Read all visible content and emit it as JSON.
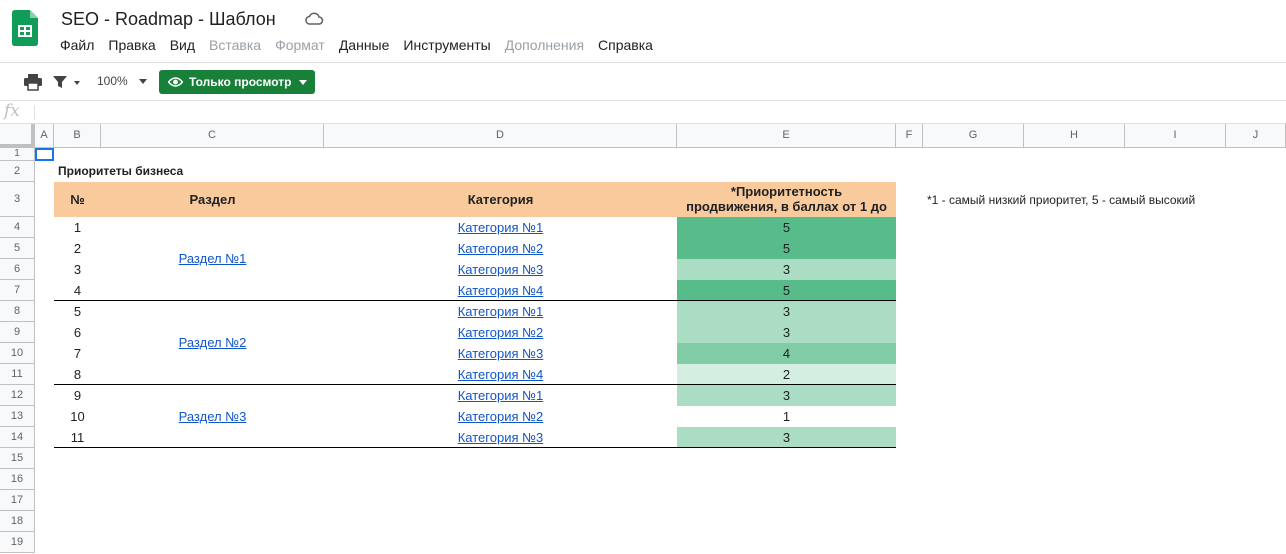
{
  "doc": {
    "title": "SEO - Roadmap - Шаблон"
  },
  "menu": [
    {
      "label": "Файл",
      "enabled": true
    },
    {
      "label": "Правка",
      "enabled": true
    },
    {
      "label": "Вид",
      "enabled": true
    },
    {
      "label": "Вставка",
      "enabled": false
    },
    {
      "label": "Формат",
      "enabled": false
    },
    {
      "label": "Данные",
      "enabled": true
    },
    {
      "label": "Инструменты",
      "enabled": true
    },
    {
      "label": "Дополнения",
      "enabled": false
    },
    {
      "label": "Справка",
      "enabled": true
    }
  ],
  "toolbar": {
    "zoom": "100%",
    "view_only_label": "Только просмотр"
  },
  "formula_bar": {
    "fx_label": "fx",
    "value": ""
  },
  "columns": [
    "A",
    "B",
    "C",
    "D",
    "E",
    "F",
    "G",
    "H",
    "I",
    "J"
  ],
  "rows": [
    "1",
    "2",
    "3",
    "4",
    "5",
    "6",
    "7",
    "8",
    "9",
    "10",
    "11",
    "12",
    "13",
    "14",
    "15",
    "16",
    "17",
    "18",
    "19"
  ],
  "sheet": {
    "title": "Приоритеты бизнеса",
    "headers": {
      "num": "№",
      "section": "Раздел",
      "category": "Категория",
      "priority_line1": "*Приоритетность",
      "priority_line2": "продвижения, в баллах от 1 до"
    },
    "note": "*1 - самый низкий приоритет, 5 - самый высокий",
    "sections": [
      "Раздел №1",
      "Раздел №2",
      "Раздел №3"
    ],
    "items": [
      {
        "num": "1",
        "category": "Категория №1",
        "score": "5",
        "color": "#57bb8a"
      },
      {
        "num": "2",
        "category": "Категория №2",
        "score": "5",
        "color": "#57bb8a"
      },
      {
        "num": "3",
        "category": "Категория №3",
        "score": "3",
        "color": "#abdcc4"
      },
      {
        "num": "4",
        "category": "Категория №4",
        "score": "5",
        "color": "#57bb8a"
      },
      {
        "num": "5",
        "category": "Категория №1",
        "score": "3",
        "color": "#abdcc4"
      },
      {
        "num": "6",
        "category": "Категория №2",
        "score": "3",
        "color": "#abdcc4"
      },
      {
        "num": "7",
        "category": "Категория №3",
        "score": "4",
        "color": "#81cca7"
      },
      {
        "num": "8",
        "category": "Категория №4",
        "score": "2",
        "color": "#d5eee2"
      },
      {
        "num": "9",
        "category": "Категория №1",
        "score": "3",
        "color": "#abdcc4"
      },
      {
        "num": "10",
        "category": "Категория №2",
        "score": "1",
        "color": "#ffffff"
      },
      {
        "num": "11",
        "category": "Категория №3",
        "score": "3",
        "color": "#abdcc4"
      }
    ]
  },
  "colors": {
    "header_band": "#f9cb9c",
    "brand_green": "#188038",
    "link": "#1155cc"
  }
}
